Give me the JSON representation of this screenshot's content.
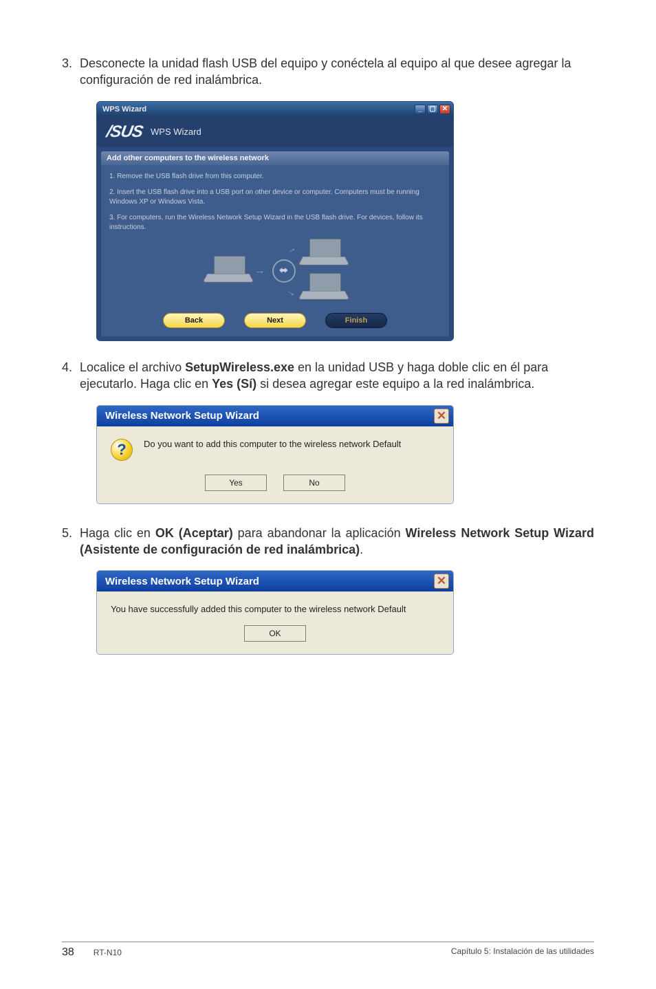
{
  "steps": {
    "s3": {
      "num": "3.",
      "text_a": "Desconecte la unidad flash USB del equipo y conéctela al equipo al que desee agregar la configuración de red inalámbrica."
    },
    "s4": {
      "num": "4.",
      "pre": "Localice el archivo ",
      "b1": "SetupWireless.exe",
      "mid": " en la unidad USB y haga doble clic en él para ejecutarlo. Haga clic en ",
      "b2": "Yes (Sí)",
      "post": " si desea agregar este equipo a la red inalámbrica."
    },
    "s5": {
      "num": "5.",
      "pre": "Haga clic en ",
      "b1": "OK (Aceptar)",
      "mid": " para abandonar la aplicación ",
      "b2": "Wireless Network Setup Wizard (Asistente de configuración de red inalámbrica)",
      "post": "."
    }
  },
  "wps": {
    "winTitle": "WPS Wizard",
    "bandLogo": "/SUS",
    "bandLabel": "WPS Wizard",
    "heading": "Add other computers to the wireless network",
    "line1": "1. Remove the USB flash drive from this computer.",
    "line2": "2. Insert the USB flash drive into a USB port on other device or computer. Computers must be running Windows XP or Windows Vista.",
    "line3": "3. For computers, run the Wireless Network Setup Wizard in the USB flash drive. For devices, follow its instructions.",
    "usbGlyph": "⬌",
    "btnBack": "Back",
    "btnNext": "Next",
    "btnFinish": "Finish"
  },
  "dialog1": {
    "title": "Wireless Network Setup Wizard",
    "close": "✕",
    "q": "?",
    "msg": "Do you want to add this computer to the wireless network Default",
    "yes": "Yes",
    "no": "No"
  },
  "dialog2": {
    "title": "Wireless Network Setup Wizard",
    "close": "✕",
    "msg": "You have successfully added this computer to the wireless network Default",
    "ok": "OK"
  },
  "footer": {
    "page": "38",
    "model": "RT-N10",
    "chapter": "Capítulo 5: Instalación de las utilidades"
  }
}
